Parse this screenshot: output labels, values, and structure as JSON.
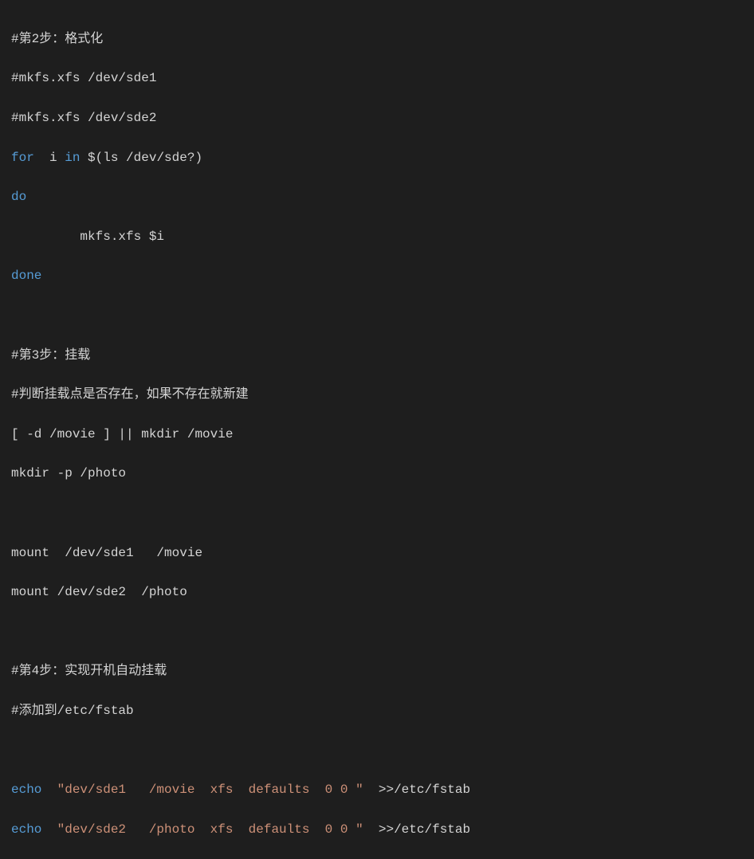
{
  "lines": {
    "l1": "#第2步：格式化",
    "l2": "#mkfs.xfs /dev/sde1",
    "l3": "#mkfs.xfs /dev/sde2",
    "l4_kw1": "for",
    "l4_mid": "  i ",
    "l4_kw2": "in",
    "l4_rest": " $(ls /dev/sde?)",
    "l5_kw": "do",
    "l6": "         mkfs.xfs $i",
    "l7_kw": "done",
    "l8": "",
    "l9": "#第3步：挂载",
    "l10": "#判断挂载点是否存在，如果不存在就新建",
    "l11": "[ -d /movie ] || mkdir /movie",
    "l12": "mkdir -p /photo",
    "l13": "",
    "l14": "mount  /dev/sde1   /movie",
    "l15": "mount /dev/sde2  /photo",
    "l16": "",
    "l17": "#第4步：实现开机自动挂载",
    "l18": "#添加到/etc/fstab",
    "l19": "",
    "l20_kw": "echo",
    "l20_str": "  \"dev/sde1   /movie  xfs  defaults  0 0 \"",
    "l20_rest": "  >>/etc/fstab",
    "l21_kw": "echo",
    "l21_str": "  \"dev/sde2   /photo  xfs  defaults  0 0 \"",
    "l21_rest": "  >>/etc/fstab"
  }
}
